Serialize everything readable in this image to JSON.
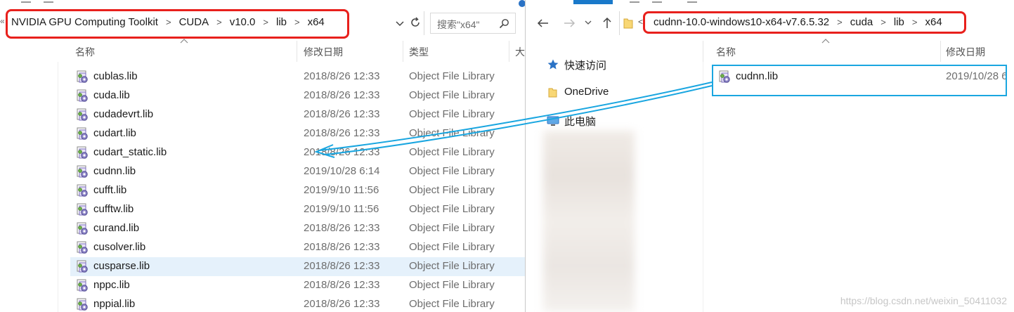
{
  "left_window": {
    "path": [
      "NVIDIA GPU Computing Toolkit",
      "CUDA",
      "v10.0",
      "lib",
      "x64"
    ],
    "search_placeholder": "搜索\"x64\"",
    "columns": {
      "name": "名称",
      "date": "修改日期",
      "type": "类型",
      "size": "大"
    },
    "files": [
      {
        "name": "cublas.lib",
        "date": "2018/8/26 12:33",
        "type": "Object File Library"
      },
      {
        "name": "cuda.lib",
        "date": "2018/8/26 12:33",
        "type": "Object File Library"
      },
      {
        "name": "cudadevrt.lib",
        "date": "2018/8/26 12:33",
        "type": "Object File Library"
      },
      {
        "name": "cudart.lib",
        "date": "2018/8/26 12:33",
        "type": "Object File Library"
      },
      {
        "name": "cudart_static.lib",
        "date": "2018/8/26 12:33",
        "type": "Object File Library"
      },
      {
        "name": "cudnn.lib",
        "date": "2019/10/28 6:14",
        "type": "Object File Library"
      },
      {
        "name": "cufft.lib",
        "date": "2019/9/10 11:56",
        "type": "Object File Library"
      },
      {
        "name": "cufftw.lib",
        "date": "2019/9/10 11:56",
        "type": "Object File Library"
      },
      {
        "name": "curand.lib",
        "date": "2018/8/26 12:33",
        "type": "Object File Library"
      },
      {
        "name": "cusolver.lib",
        "date": "2018/8/26 12:33",
        "type": "Object File Library"
      },
      {
        "name": "cusparse.lib",
        "date": "2018/8/26 12:33",
        "type": "Object File Library"
      },
      {
        "name": "nppc.lib",
        "date": "2018/8/26 12:33",
        "type": "Object File Library"
      },
      {
        "name": "nppial.lib",
        "date": "2018/8/26 12:33",
        "type": "Object File Library"
      }
    ],
    "selected_index": 10
  },
  "right_window": {
    "path": [
      "cudnn-10.0-windows10-x64-v7.6.5.32",
      "cuda",
      "lib",
      "x64"
    ],
    "columns": {
      "name": "名称",
      "date": "修改日期"
    },
    "nav": [
      {
        "label": "快速访问",
        "icon": "star-icon"
      },
      {
        "label": "OneDrive",
        "icon": "folder-icon"
      },
      {
        "label": "此电脑",
        "icon": "computer-icon"
      }
    ],
    "files": [
      {
        "name": "cudnn.lib",
        "date": "2019/10/28 6"
      }
    ]
  },
  "colors": {
    "annotation_red": "#e8201c",
    "annotation_blue": "#1aa6e0",
    "selected_row": "#e5f1fb"
  },
  "watermark": "https://blog.csdn.net/weixin_50411032"
}
